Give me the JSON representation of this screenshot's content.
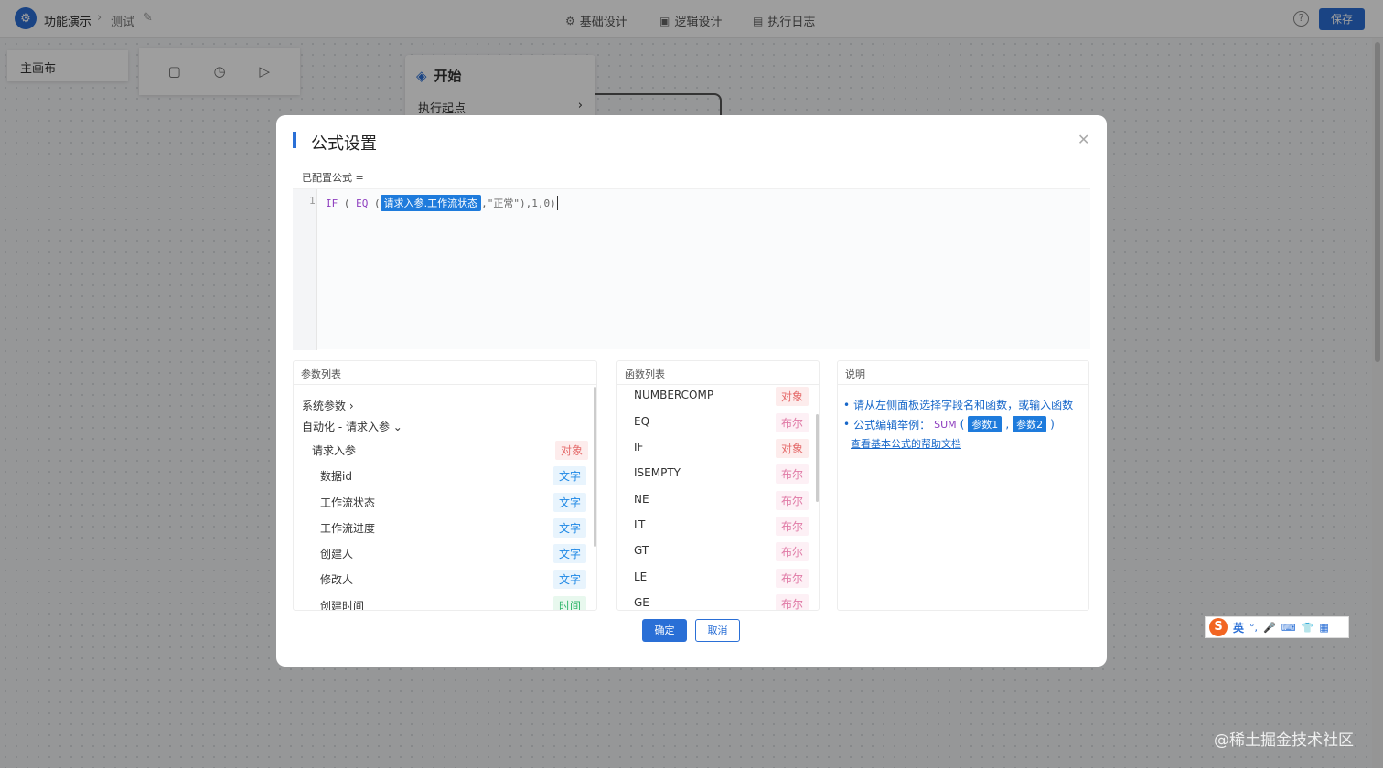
{
  "topbar": {
    "app_name": "功能演示",
    "page_name": "测试",
    "tabs": [
      "基础设计",
      "逻辑设计",
      "执行日志"
    ],
    "save_label": "保存"
  },
  "canvas": {
    "main_tab": "主画布",
    "start_node_title": "开始",
    "start_node_row": "执行起点"
  },
  "modal": {
    "title": "公式设置",
    "formula_label": "已配置公式 =",
    "line_no": "1",
    "code": {
      "if": "IF",
      "eq": "EQ",
      "chip": "请求入参.工作流状态",
      "tail": ",\"正常\"),1,0)"
    },
    "params": {
      "header": "参数列表",
      "groups": [
        "系统参数",
        "自动化 - 请求入参"
      ],
      "items": [
        {
          "label": "请求入参",
          "type": "对象"
        },
        {
          "label": "数据id",
          "type": "文字"
        },
        {
          "label": "工作流状态",
          "type": "文字"
        },
        {
          "label": "工作流进度",
          "type": "文字"
        },
        {
          "label": "创建人",
          "type": "文字"
        },
        {
          "label": "修改人",
          "type": "文字"
        },
        {
          "label": "创建时间",
          "type": "时间"
        }
      ]
    },
    "functions": {
      "header": "函数列表",
      "items": [
        {
          "label": "NUMBERCOMP",
          "type": "对象"
        },
        {
          "label": "EQ",
          "type": "布尔"
        },
        {
          "label": "IF",
          "type": "对象"
        },
        {
          "label": "ISEMPTY",
          "type": "布尔"
        },
        {
          "label": "NE",
          "type": "布尔"
        },
        {
          "label": "LT",
          "type": "布尔"
        },
        {
          "label": "GT",
          "type": "布尔"
        },
        {
          "label": "LE",
          "type": "布尔"
        },
        {
          "label": "GE",
          "type": "布尔"
        }
      ]
    },
    "desc": {
      "header": "说明",
      "line1": "请从左侧面板选择字段名和函数，或输入函数",
      "line2_prefix": "公式编辑举例：",
      "sum": "SUM",
      "arg1": "参数1",
      "arg2": "参数2",
      "link": "查看基本公式的帮助文档"
    },
    "ok_label": "确定",
    "cancel_label": "取消"
  },
  "ime": {
    "mode": "英"
  },
  "watermark": "@稀土掘金技术社区",
  "colors": {
    "primary": "#2a6fd6",
    "object_tag": "#e56b6b",
    "text_tag": "#1e88e5",
    "time_tag": "#2eb56a",
    "bool_tag": "#e07aa6"
  }
}
